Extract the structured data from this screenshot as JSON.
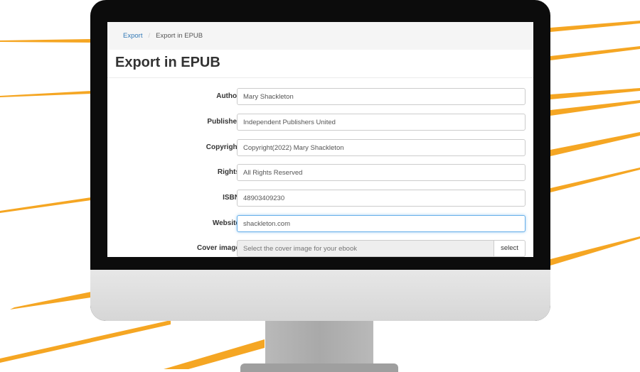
{
  "colors": {
    "accent_rays": "#f5a623",
    "monitor_bezel": "#0c0c0c",
    "monitor_chin": "#dcdcdc",
    "link": "#337ab7",
    "focus_border": "#66afe9"
  },
  "breadcrumb": {
    "link_label": "Export",
    "separator": "/",
    "current_label": "Export in EPUB"
  },
  "page": {
    "title": "Export in EPUB"
  },
  "form": {
    "fields": [
      {
        "label": "Author",
        "value": "Mary Shackleton"
      },
      {
        "label": "Publisher",
        "value": "Independent Publishers United"
      },
      {
        "label": "Copyright",
        "value": "Copyright(2022) Mary Shackleton"
      },
      {
        "label": "Rights",
        "value": "All Rights Reserved"
      },
      {
        "label": "ISBN",
        "value": "48903409230"
      },
      {
        "label": "Website",
        "value": "shackleton.com",
        "focused": true
      }
    ],
    "cover": {
      "label": "Cover image",
      "placeholder": "Select the cover image for your ebook",
      "button_label": "select"
    }
  }
}
